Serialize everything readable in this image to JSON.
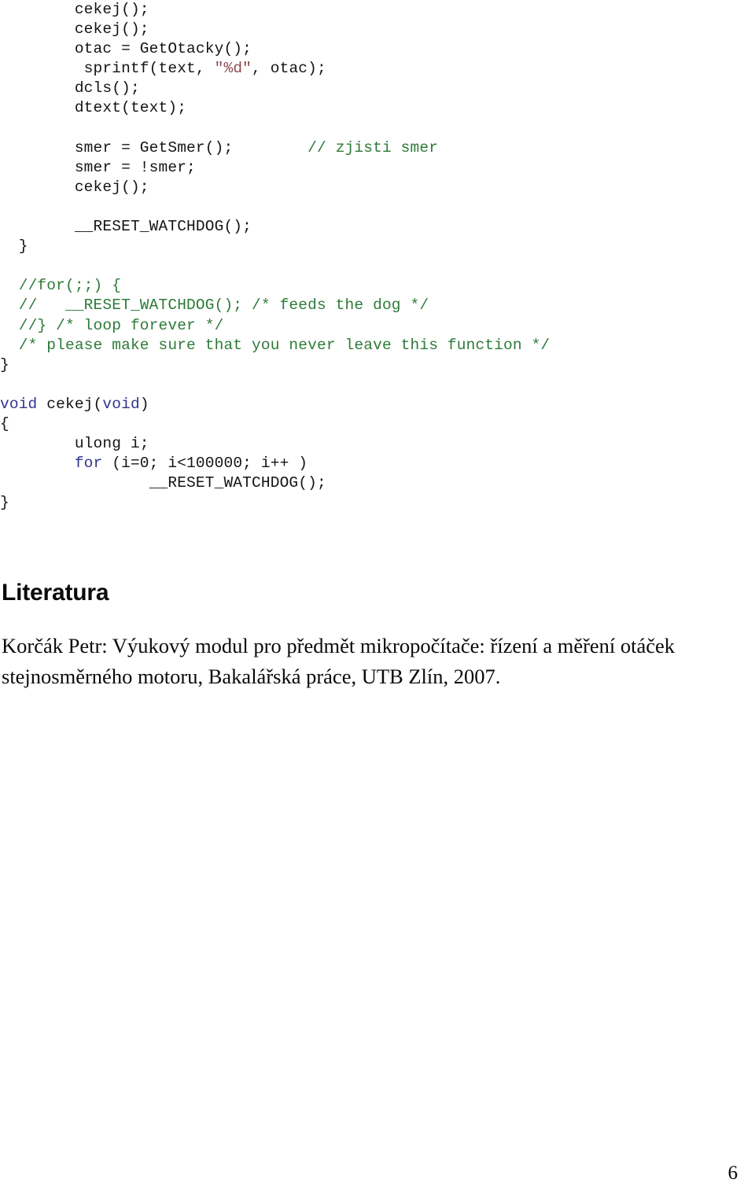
{
  "document": {
    "page_number": "6"
  },
  "code": {
    "lines": [
      {
        "indent": "        ",
        "segments": [
          {
            "text": "cekej();",
            "style": "plain"
          }
        ]
      },
      {
        "indent": "        ",
        "segments": [
          {
            "text": "cekej();",
            "style": "plain"
          }
        ]
      },
      {
        "indent": "        ",
        "segments": [
          {
            "text": "otac = GetOtacky();",
            "style": "plain"
          }
        ]
      },
      {
        "indent": "         ",
        "segments": [
          {
            "text": "sprintf(text, ",
            "style": "plain"
          },
          {
            "text": "\"%d\"",
            "style": "string"
          },
          {
            "text": ", otac);",
            "style": "plain"
          }
        ]
      },
      {
        "indent": "        ",
        "segments": [
          {
            "text": "dcls();",
            "style": "plain"
          }
        ]
      },
      {
        "indent": "        ",
        "segments": [
          {
            "text": "dtext(text);",
            "style": "plain"
          }
        ]
      },
      {
        "indent": "",
        "segments": []
      },
      {
        "indent": "        ",
        "segments": [
          {
            "text": "smer = GetSmer();        ",
            "style": "plain"
          },
          {
            "text": "// zjisti smer",
            "style": "comment"
          }
        ]
      },
      {
        "indent": "        ",
        "segments": [
          {
            "text": "smer = !smer;",
            "style": "plain"
          }
        ]
      },
      {
        "indent": "        ",
        "segments": [
          {
            "text": "cekej();",
            "style": "plain"
          }
        ]
      },
      {
        "indent": "",
        "segments": []
      },
      {
        "indent": "        ",
        "segments": [
          {
            "text": "__RESET_WATCHDOG();",
            "style": "plain"
          }
        ]
      },
      {
        "indent": "  ",
        "segments": [
          {
            "text": "}",
            "style": "brace"
          }
        ]
      },
      {
        "indent": "",
        "segments": []
      },
      {
        "indent": "  ",
        "segments": [
          {
            "text": "//for(;;) {",
            "style": "comment"
          }
        ]
      },
      {
        "indent": "  ",
        "segments": [
          {
            "text": "//   __RESET_WATCHDOG(); /* feeds the dog */",
            "style": "comment"
          }
        ]
      },
      {
        "indent": "  ",
        "segments": [
          {
            "text": "//} /* loop forever */",
            "style": "comment"
          }
        ]
      },
      {
        "indent": "  ",
        "segments": [
          {
            "text": "/* please make sure that you never leave this function */",
            "style": "comment"
          }
        ]
      },
      {
        "indent": "",
        "segments": [
          {
            "text": "}",
            "style": "brace"
          }
        ]
      },
      {
        "indent": "",
        "segments": []
      },
      {
        "indent": "",
        "segments": [
          {
            "text": "void",
            "style": "keyword"
          },
          {
            "text": " cekej(",
            "style": "plain"
          },
          {
            "text": "void",
            "style": "keyword"
          },
          {
            "text": ")",
            "style": "plain"
          }
        ]
      },
      {
        "indent": "",
        "segments": [
          {
            "text": "{",
            "style": "brace"
          }
        ]
      },
      {
        "indent": "        ",
        "segments": [
          {
            "text": "ulong i;",
            "style": "plain"
          }
        ]
      },
      {
        "indent": "        ",
        "segments": [
          {
            "text": "for",
            "style": "keyword"
          },
          {
            "text": " (i=0; i<100000; i++ )",
            "style": "plain"
          }
        ]
      },
      {
        "indent": "                ",
        "segments": [
          {
            "text": "__RESET_WATCHDOG();",
            "style": "plain"
          }
        ]
      },
      {
        "indent": "",
        "segments": [
          {
            "text": "}",
            "style": "brace"
          }
        ]
      }
    ]
  },
  "literature": {
    "heading": "Literatura",
    "citation_lines": [
      "Korčák Petr: Výukový modul pro předmět mikropočítače: řízení a měření otáček",
      "stejnosměrného motoru, Bakalářská práce, UTB Zlín, 2007."
    ]
  },
  "colors": {
    "comment": "#2d7a38",
    "keyword": "#32338f",
    "string": "#8d4a4a",
    "text": "#141414"
  }
}
